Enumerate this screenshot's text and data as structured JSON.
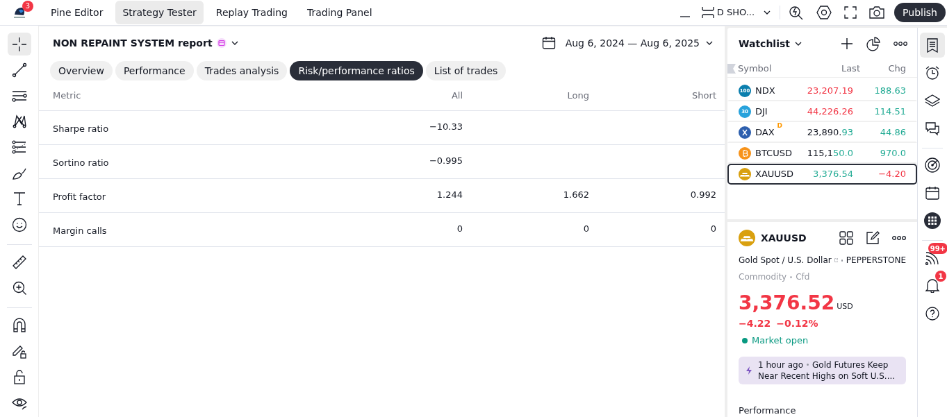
{
  "logo_badge": "3",
  "top_tabs": [
    {
      "label": "Pine Editor",
      "selected": false
    },
    {
      "label": "Strategy Tester",
      "selected": true
    },
    {
      "label": "Replay Trading",
      "selected": false
    },
    {
      "label": "Trading Panel",
      "selected": false
    }
  ],
  "layout_name": "D SHO...",
  "publish_button": "Publish",
  "left_tools": [
    {
      "kind": "crosshair",
      "selected": true
    },
    {
      "kind": "line",
      "selected": false
    },
    {
      "kind": "hlines",
      "selected": false
    },
    {
      "kind": "pattern",
      "selected": false
    },
    {
      "kind": "fib",
      "selected": false
    },
    {
      "kind": "brush",
      "selected": false
    },
    {
      "kind": "text",
      "selected": false
    },
    {
      "kind": "smiley",
      "selected": false
    },
    {
      "kind": "divider"
    },
    {
      "kind": "ruler",
      "selected": false
    },
    {
      "kind": "zoom",
      "selected": false
    },
    {
      "kind": "divider"
    },
    {
      "kind": "magnet",
      "selected": false
    },
    {
      "kind": "pencil-lock",
      "selected": false
    },
    {
      "kind": "lock",
      "selected": false
    },
    {
      "kind": "eye",
      "selected": false
    }
  ],
  "report": {
    "title": "NON REPAINT SYSTEM report",
    "date_range": "Aug 6, 2024 — Aug 6, 2025",
    "tabs": [
      {
        "label": "Overview",
        "selected": false
      },
      {
        "label": "Performance",
        "selected": false
      },
      {
        "label": "Trades analysis",
        "selected": false
      },
      {
        "label": "Risk/performance ratios",
        "selected": true
      },
      {
        "label": "List of trades",
        "selected": false
      }
    ],
    "table": {
      "columns": [
        "Metric",
        "All",
        "Long",
        "Short"
      ],
      "rows": [
        {
          "metric": "Sharpe ratio",
          "all": "−10.33"
        },
        {
          "metric": "Sortino ratio",
          "all": "−0.995"
        },
        {
          "metric": "Profit factor",
          "all": "1.244",
          "long": "1.662",
          "short": "0.992"
        },
        {
          "metric": "Margin calls",
          "all": "0",
          "long": "0",
          "short": "0"
        }
      ]
    }
  },
  "watchlist": {
    "title": "Watchlist",
    "columns": [
      "Symbol",
      "Last",
      "Chg"
    ],
    "rows": [
      {
        "symbol": "NDX",
        "kind": "text",
        "logo_text": "100",
        "color": "#0b7fae",
        "last_changed": "23,207.19",
        "tick_up": false,
        "change": "188.63",
        "change_up": true,
        "selected": false
      },
      {
        "symbol": "DJI",
        "kind": "text",
        "logo_text": "30",
        "color": "#27a2dc",
        "last_changed": "44,226.26",
        "tick_up": false,
        "change": "114.51",
        "change_up": true,
        "selected": false
      },
      {
        "symbol": "DAX",
        "kind": "cross",
        "color": "#2d5fae",
        "badge": "D",
        "last_same": "23,890.",
        "last_changed": "93",
        "tick_up": true,
        "change": "44.86",
        "change_up": true,
        "selected": false
      },
      {
        "symbol": "BTCUSD",
        "kind": "coin",
        "color": "#f7931a",
        "last_same": "115,1",
        "last_changed": "50.0",
        "tick_up": true,
        "change": "970.0",
        "change_up": true,
        "selected": false
      },
      {
        "symbol": "XAUUSD",
        "kind": "bars",
        "color": "#d9a00f",
        "last_changed": "3,376.54",
        "tick_up": true,
        "change": "−4.20",
        "change_up": false,
        "selected": true
      }
    ]
  },
  "details": {
    "symbol": "XAUUSD",
    "description": "Gold Spot / U.S. Dollar",
    "exchange": "PEPPERSTONE",
    "type": "Commodity",
    "subtype": "Cfd",
    "price": "3,376.52",
    "currency": "USD",
    "change": "−4.22",
    "change_percent": "−0.12%",
    "change_up": false,
    "market_status": "Market open",
    "news": {
      "time": "1 hour ago",
      "headline_1": "Gold Futures Keep",
      "headline_2": "Near Recent Highs on Soft U.S...."
    },
    "section": "Performance"
  },
  "right_bar": [
    {
      "kind": "watchlist",
      "selected": true
    },
    {
      "kind": "alarm",
      "selected": false
    },
    {
      "kind": "layers",
      "selected": false
    },
    {
      "kind": "chat",
      "selected": false
    },
    {
      "kind": "divider"
    },
    {
      "kind": "target",
      "selected": false
    },
    {
      "kind": "calendar",
      "selected": false
    },
    {
      "kind": "apps",
      "selected": false
    },
    {
      "kind": "divider"
    },
    {
      "kind": "feed",
      "selected": false,
      "badge": "99+"
    },
    {
      "kind": "bell",
      "selected": false,
      "badge": "1"
    },
    {
      "kind": "help",
      "selected": false
    }
  ]
}
